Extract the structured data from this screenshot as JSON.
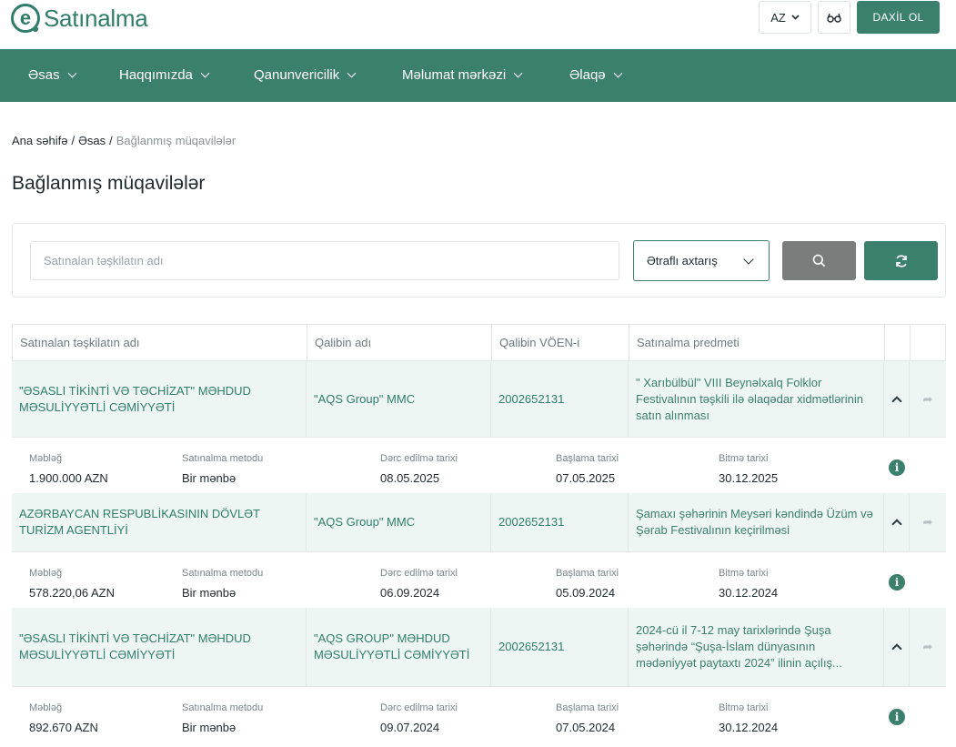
{
  "header": {
    "logo_letter": "e",
    "logo_text": "Satınalma",
    "lang": "AZ",
    "glasses_icon": "glasses-icon",
    "login": "DAXİL OL"
  },
  "nav": [
    {
      "label": "Əsas"
    },
    {
      "label": "Haqqımızda"
    },
    {
      "label": "Qanunvericilik"
    },
    {
      "label": "Məlumat mərkəzi"
    },
    {
      "label": "Əlaqə"
    }
  ],
  "breadcrumb": {
    "home": "Ana səhifə",
    "sep": "/",
    "section": "Əsas",
    "current": "Bağlanmış müqavilələr"
  },
  "page_title": "Bağlanmış müqavilələr",
  "search": {
    "placeholder": "Satınalan təşkilatın adı",
    "advanced": "Ətraflı axtarış"
  },
  "table": {
    "headers": [
      "Satınalan təşkilatın adı",
      "Qalibin adı",
      "Qalibin VÖEN-i",
      "Satınalma predmeti"
    ],
    "detail_labels": {
      "amount": "Məbləğ",
      "method": "Satınalma metodu",
      "published": "Dərc edilmə tarixi",
      "start": "Başlama tarixi",
      "end": "Bitmə tarixi"
    },
    "rows": [
      {
        "org": "\"ƏSASLI TİKİNTİ VƏ TƏCHİZAT\" MƏHDUD MƏSULİYYƏTLİ CƏMİYYƏTİ",
        "winner": "\"AQS Group\" MMC",
        "voen": "2002652131",
        "subject": "\" Xarıbülbül\" VIII Beynəlxalq Folklor Festivalının təşkili ilə əlaqədar xidmətlərinin satın alınması",
        "amount": "1.900.000 AZN",
        "method": "Bir mənbə",
        "published": "08.05.2025",
        "start": "07.05.2025",
        "end": "30.12.2025"
      },
      {
        "org": "AZƏRBAYCAN RESPUBLİKASININ DÖVLƏT TURİZM AGENTLİYİ",
        "winner": "\"AQS Group\" MMC",
        "voen": "2002652131",
        "subject": "Şamaxı şəhərinin Meysəri kəndində Üzüm və Şərab Festivalının keçirilməsi",
        "amount": "578.220,06 AZN",
        "method": "Bir mənbə",
        "published": "06.09.2024",
        "start": "05.09.2024",
        "end": "30.12.2024"
      },
      {
        "org": "\"ƏSASLI TİKİNTİ VƏ TƏCHİZAT\" MƏHDUD MƏSULİYYƏTLİ CƏMİYYƏTİ",
        "winner": "\"AQS GROUP\" MƏHDUD MƏSULİYYƏTLİ CƏMİYYƏTİ",
        "voen": "2002652131",
        "subject": "2024-cü il 7-12 may tarixlərində Şuşa şəhərində “Şuşa-İslam dünyasının mədəniyyət paytaxtı 2024” ilinin açılış...",
        "amount": "892.670 AZN",
        "method": "Bir mənbə",
        "published": "09.07.2024",
        "start": "07.05.2024",
        "end": "30.12.2024"
      }
    ]
  },
  "colors": {
    "primary": "#3b7f6d",
    "row_bg": "#eef6f3",
    "search_btn": "#7b7d7d"
  }
}
